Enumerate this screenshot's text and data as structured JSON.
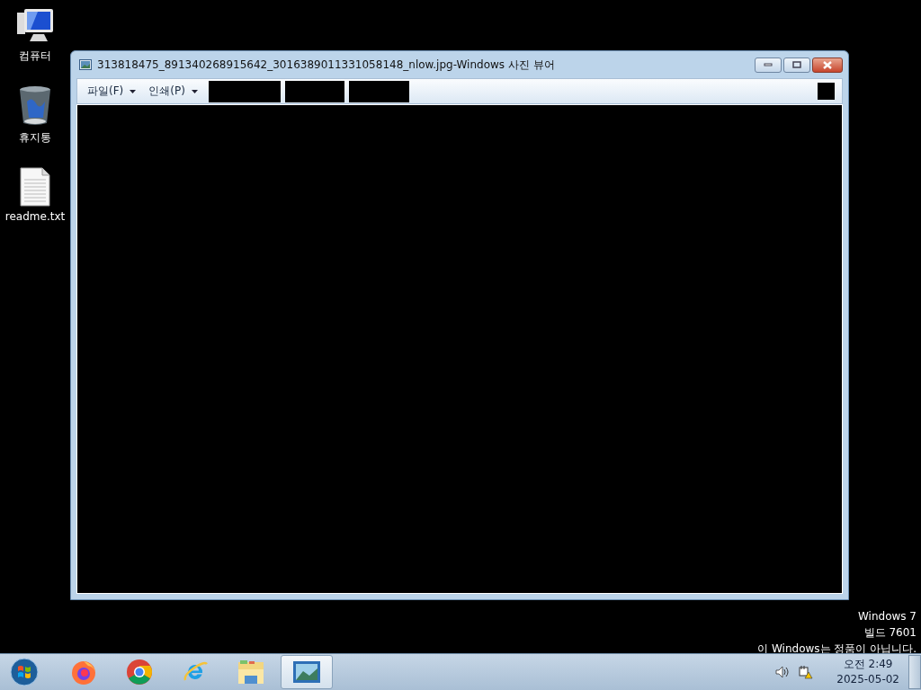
{
  "desktop_icons": [
    {
      "kind": "computer",
      "label": "컴퓨터"
    },
    {
      "kind": "recycle",
      "label": "휴지통"
    },
    {
      "kind": "textfile",
      "label": "readme.txt"
    }
  ],
  "window": {
    "title": "313818475_891340268915642_3016389011331058148_nlow.jpg-Windows 사진 뷰어",
    "menus": [
      {
        "label": "파일(F)"
      },
      {
        "label": "인쇄(P)"
      }
    ]
  },
  "watermark_notice": [
    "Windows 7",
    "빌드 7601",
    "이 Windows는 정품이 아닙니다."
  ],
  "taskbar": {
    "apps": [
      {
        "kind": "firefox",
        "selected": false
      },
      {
        "kind": "chrome",
        "selected": false
      },
      {
        "kind": "ie",
        "selected": false
      },
      {
        "kind": "explorer",
        "selected": false
      },
      {
        "kind": "photos",
        "selected": true
      }
    ],
    "clock": {
      "time": "오전 2:49",
      "date": "2025-05-02"
    }
  }
}
